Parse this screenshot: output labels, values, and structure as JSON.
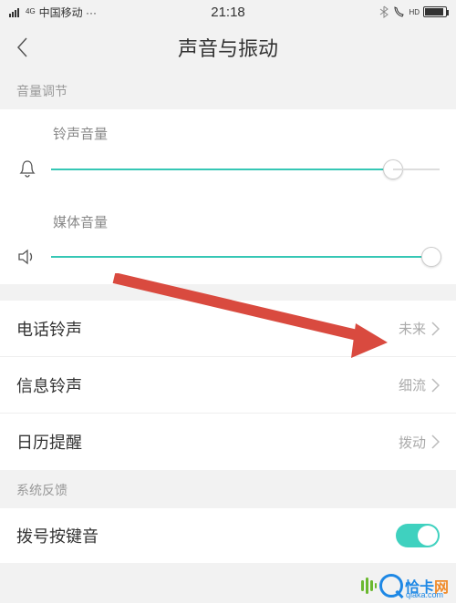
{
  "status": {
    "signal_label": "4G",
    "carrier": "中国移动 ···",
    "time": "21:18",
    "hd": "HD"
  },
  "header": {
    "title": "声音与振动"
  },
  "sections": {
    "volume_header": "音量调节",
    "feedback_header": "系统反馈"
  },
  "sliders": {
    "ringer": {
      "label": "铃声音量",
      "value_percent": 88
    },
    "media": {
      "label": "媒体音量",
      "value_percent": 98
    }
  },
  "list_items": {
    "phone_ringtone": {
      "title": "电话铃声",
      "value": "未来"
    },
    "message_ringtone": {
      "title": "信息铃声",
      "value": "细流"
    },
    "calendar_reminder": {
      "title": "日历提醒",
      "value": "拨动"
    }
  },
  "toggles": {
    "dialpad_tone": {
      "title": "拨号按键音",
      "on": true
    }
  },
  "watermark": {
    "brand_cn": "恰卡",
    "brand_suffix": "网",
    "domain": "qiaka.com"
  }
}
